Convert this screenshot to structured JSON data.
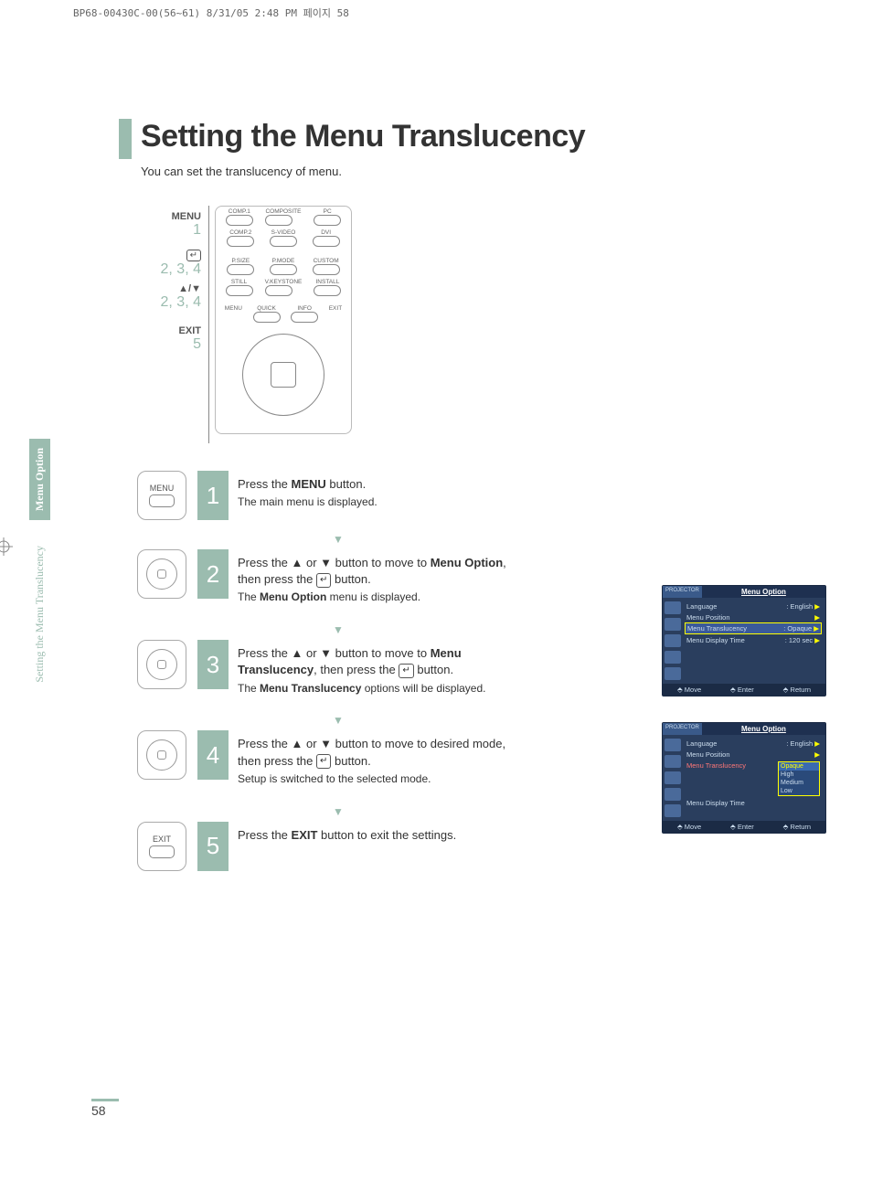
{
  "header_line": "BP68-00430C-00(56~61)  8/31/05  2:48 PM  페이지 58",
  "title": "Setting the Menu Translucency",
  "subtitle": "You can set the translucency of menu.",
  "side_tab_1": "Menu Option",
  "side_tab_2": "Setting the Menu Translucency",
  "page_number": "58",
  "remote_labels": {
    "menu": "MENU",
    "n1": "1",
    "n234a": "2, 3, 4",
    "arrows": "▲/▼",
    "n234b": "2, 3, 4",
    "exit": "EXIT",
    "n5": "5"
  },
  "remote_buttons": {
    "r1": [
      "COMP.1",
      "COMPOSITE",
      "PC"
    ],
    "r2": [
      "COMP.2",
      "S-VIDEO",
      "DVI"
    ],
    "r3": [
      "P.SIZE",
      "P.MODE",
      "CUSTOM"
    ],
    "r4": [
      "STILL",
      "V.KEYSTONE",
      "INSTALL"
    ],
    "q_row": [
      "MENU",
      "QUICK",
      "INFO",
      "EXIT"
    ]
  },
  "steps": [
    {
      "num": "1",
      "icon_label": "MENU",
      "main_a": "Press the ",
      "main_bold": "MENU",
      "main_b": " button.",
      "sub": "The main menu is displayed."
    },
    {
      "num": "2",
      "icon_label": "",
      "main": "Press the ▲ or ▼ button to move to <b>Menu Option</b>, then press the <span class=\"enter-icon\">↵</span> button.",
      "sub": "The <b>Menu Option</b> menu is displayed."
    },
    {
      "num": "3",
      "icon_label": "",
      "main": "Press the ▲ or ▼ button to move to <b>Menu Translucency</b>, then press the <span class=\"enter-icon\">↵</span> button.",
      "sub": "The <b>Menu Translucency</b> options will be displayed."
    },
    {
      "num": "4",
      "icon_label": "",
      "main": "Press the ▲ or ▼ button to move to desired mode, then press the <span class=\"enter-icon\">↵</span> button.",
      "sub": "Setup is switched to the selected mode."
    },
    {
      "num": "5",
      "icon_label": "EXIT",
      "main": "Press the <b>EXIT</b> button to exit the settings.",
      "sub": ""
    }
  ],
  "osd": {
    "title": "Menu Option",
    "projector": "PROJECTOR",
    "rows": [
      {
        "label": "Language",
        "value": ": English"
      },
      {
        "label": "Menu Position",
        "value": ""
      },
      {
        "label": "Menu Translucency",
        "value": ": Opaque",
        "selected": true
      },
      {
        "label": "Menu Display Time",
        "value": ": 120 sec"
      }
    ],
    "footer": [
      "Move",
      "Enter",
      "Return"
    ],
    "popup_options": [
      "Opaque",
      "High",
      "Medium",
      "Low"
    ],
    "sel_label": "Menu Translucency",
    "sel_time_label": "Menu Display Time"
  }
}
